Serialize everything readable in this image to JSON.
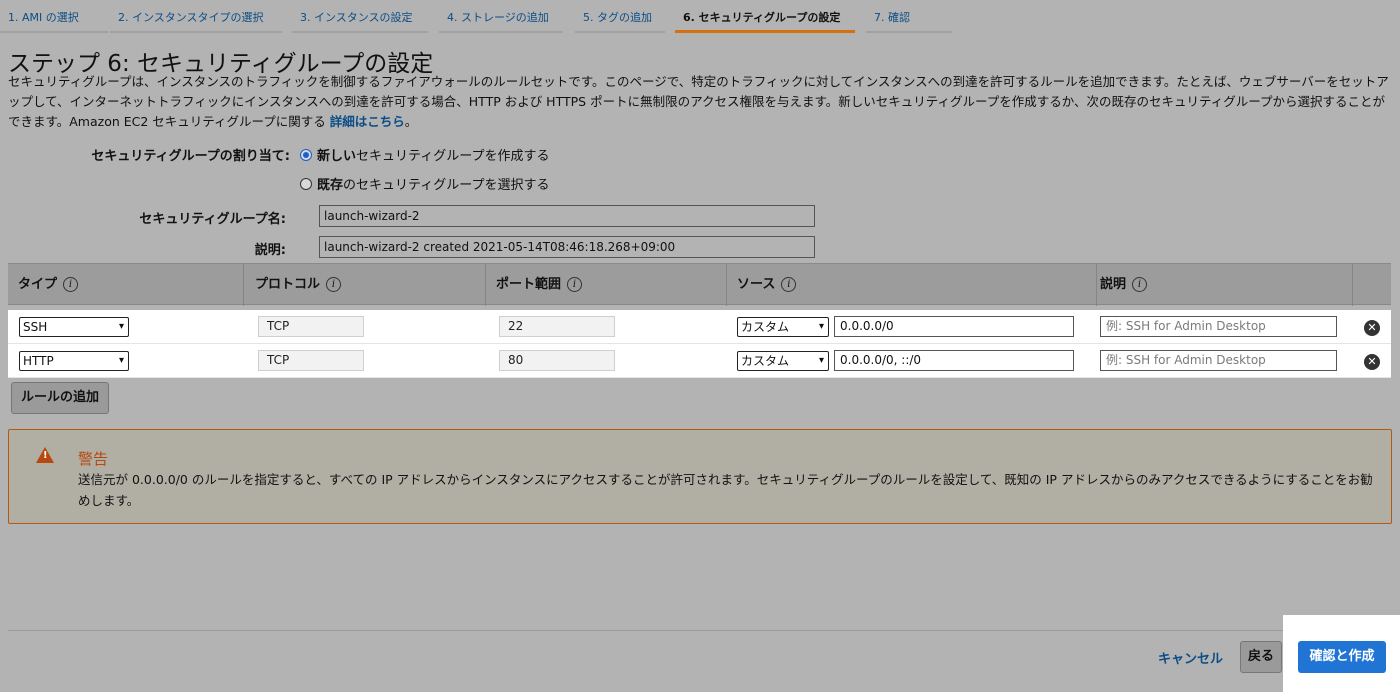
{
  "tabs": [
    {
      "label": "1. AMI の選択"
    },
    {
      "label": "2. インスタンスタイプの選択"
    },
    {
      "label": "3. インスタンスの設定"
    },
    {
      "label": "4. ストレージの追加"
    },
    {
      "label": "5. タグの追加"
    },
    {
      "label": "6. セキュリティグループの設定",
      "active": true
    },
    {
      "label": "7. 確認"
    }
  ],
  "page": {
    "title": "ステップ 6: セキュリティグループの設定",
    "intro": "セキュリティグループは、インスタンスのトラフィックを制御するファイアウォールのルールセットです。このページで、特定のトラフィックに対してインスタンスへの到達を許可するルールを追加できます。たとえば、ウェブサーバーをセットアップして、インターネットトラフィックにインスタンスへの到達を許可する場合、HTTP および HTTPS ポートに無制限のアクセス権限を与えます。新しいセキュリティグループを作成するか、次の既存のセキュリティグループから選択することができます。Amazon EC2 セキュリティグループに関する",
    "learn_more": "詳細はこちら",
    "period": "。"
  },
  "assign": {
    "label": "セキュリティグループの割り当て:",
    "option_new_bold": "新しい",
    "option_new_rest": "セキュリティグループを作成する",
    "option_existing_bold": "既存",
    "option_existing_rest": "のセキュリティグループを選択する",
    "selected": "new"
  },
  "group_name": {
    "label": "セキュリティグループ名:",
    "value": "launch-wizard-2"
  },
  "description": {
    "label": "説明:",
    "value": "launch-wizard-2 created 2021-05-14T08:46:18.268+09:00"
  },
  "table": {
    "headers": {
      "type": "タイプ",
      "protocol": "プロトコル",
      "port": "ポート範囲",
      "source": "ソース",
      "desc": "説明"
    },
    "info_glyph": "i",
    "rows": [
      {
        "type": "SSH",
        "protocol": "TCP",
        "port": "22",
        "source_mode": "カスタム",
        "source": "0.0.0.0/0",
        "desc_placeholder": "例: SSH for Admin Desktop"
      },
      {
        "type": "HTTP",
        "protocol": "TCP",
        "port": "80",
        "source_mode": "カスタム",
        "source": "0.0.0.0/0, ::/0",
        "desc_placeholder": "例: SSH for Admin Desktop"
      }
    ]
  },
  "add_rule_label": "ルールの追加",
  "warning": {
    "title": "警告",
    "text": "送信元が 0.0.0.0/0 のルールを指定すると、すべての IP アドレスからインスタンスにアクセスすることが許可されます。セキュリティグループのルールを設定して、既知の IP アドレスからのみアクセスできるようにすることをお勧めします。"
  },
  "footer": {
    "cancel": "キャンセル",
    "back": "戻る",
    "review": "確認と作成"
  },
  "colors": {
    "accent": "#1f74d4",
    "tab_active": "#d4700f",
    "warning": "#b7480e",
    "link": "#0b4d86"
  }
}
